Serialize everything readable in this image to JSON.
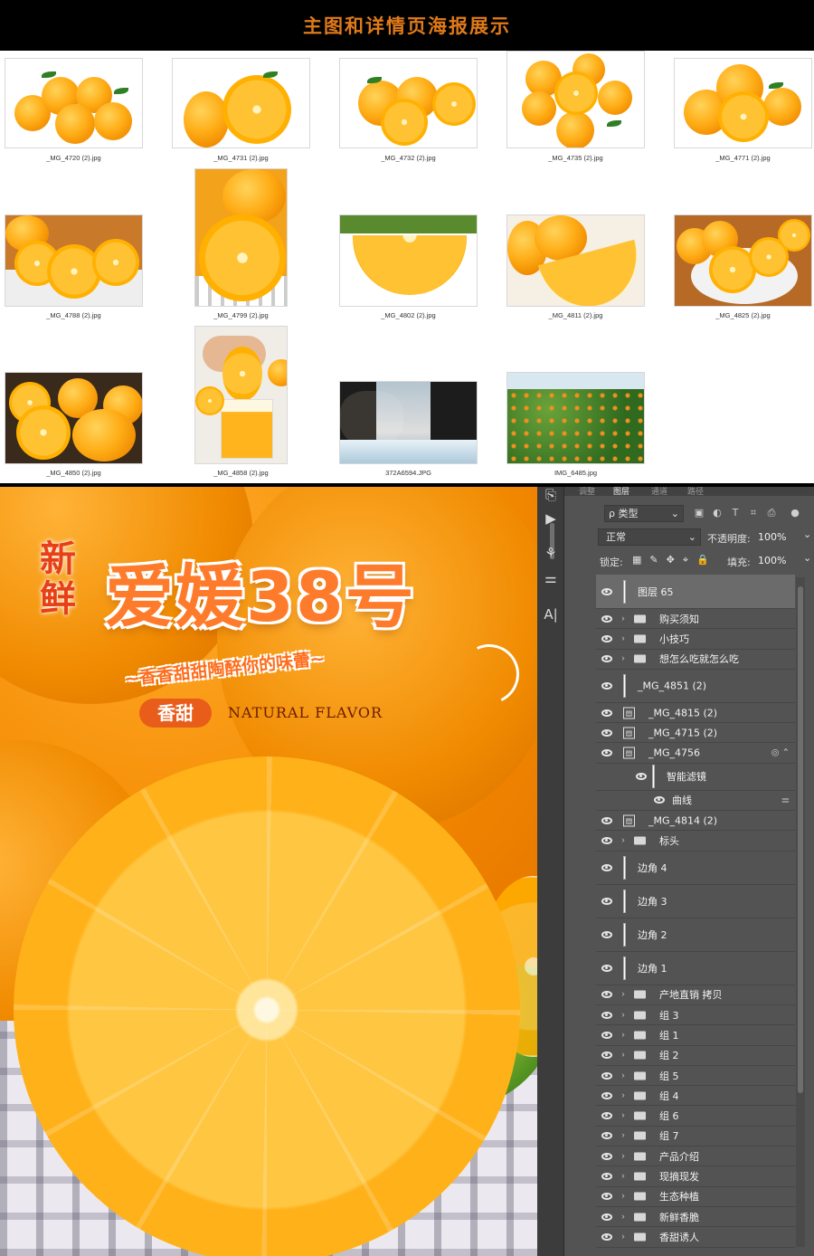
{
  "header": {
    "title": "主图和详情页海报展示"
  },
  "thumbnails": [
    {
      "caption": "_MG_4720 (2).jpg"
    },
    {
      "caption": "_MG_4731 (2).jpg"
    },
    {
      "caption": "_MG_4732 (2).jpg"
    },
    {
      "caption": "_MG_4735 (2).jpg"
    },
    {
      "caption": "_MG_4771 (2).jpg"
    },
    {
      "caption": "_MG_4788 (2).jpg"
    },
    {
      "caption": "_MG_4799 (2).jpg"
    },
    {
      "caption": "_MG_4802 (2).jpg"
    },
    {
      "caption": "_MG_4811 (2).jpg"
    },
    {
      "caption": "_MG_4825 (2).jpg"
    },
    {
      "caption": "_MG_4850 (2).jpg"
    },
    {
      "caption": "_MG_4858 (2).jpg"
    },
    {
      "caption": "372A6594.JPG"
    },
    {
      "caption": "IMG_6485.jpg"
    }
  ],
  "poster": {
    "title_small": "新鲜",
    "title_big": "爱媛38号",
    "slogan": "~香香甜甜陶醉你的味蕾~",
    "badge": "香甜",
    "tagline": "NATURAL FLAVOR"
  },
  "photoshop": {
    "tabs": [
      "调整",
      "图层",
      "通道",
      "路径"
    ],
    "filter_label": "ρ 类型",
    "blend_mode": "正常",
    "opacity_label": "不透明度:",
    "opacity_value": "100%",
    "lock_label": "锁定:",
    "fill_label": "填充:",
    "fill_value": "100%",
    "layers": [
      {
        "name": "图层 65",
        "type": "layer",
        "selected": true
      },
      {
        "name": "购买须知",
        "type": "group"
      },
      {
        "name": "小技巧",
        "type": "group"
      },
      {
        "name": "想怎么吃就怎么吃",
        "type": "group"
      },
      {
        "name": "_MG_4851 (2)",
        "type": "layer"
      },
      {
        "name": "_MG_4815 (2)",
        "type": "smart"
      },
      {
        "name": "_MG_4715 (2)",
        "type": "smart"
      },
      {
        "name": "_MG_4756",
        "type": "smart"
      },
      {
        "name": "智能滤镜",
        "type": "filter"
      },
      {
        "name": "曲线",
        "type": "filter-item"
      },
      {
        "name": "_MG_4814 (2)",
        "type": "smart"
      },
      {
        "name": "标头",
        "type": "group"
      },
      {
        "name": "边角 4",
        "type": "layer"
      },
      {
        "name": "边角 3",
        "type": "layer"
      },
      {
        "name": "边角 2",
        "type": "layer"
      },
      {
        "name": "边角 1",
        "type": "layer"
      },
      {
        "name": "产地直销 拷贝",
        "type": "group"
      },
      {
        "name": "组 3",
        "type": "group"
      },
      {
        "name": "组 1",
        "type": "group"
      },
      {
        "name": "组 2",
        "type": "group"
      },
      {
        "name": "组 5",
        "type": "group"
      },
      {
        "name": "组 4",
        "type": "group"
      },
      {
        "name": "组 6",
        "type": "group"
      },
      {
        "name": "组 7",
        "type": "group"
      },
      {
        "name": "产品介绍",
        "type": "group"
      },
      {
        "name": "现摘现发",
        "type": "group"
      },
      {
        "name": "生态种植",
        "type": "group"
      },
      {
        "name": "新鲜香脆",
        "type": "group"
      },
      {
        "name": "香甜诱人",
        "type": "group"
      }
    ]
  }
}
